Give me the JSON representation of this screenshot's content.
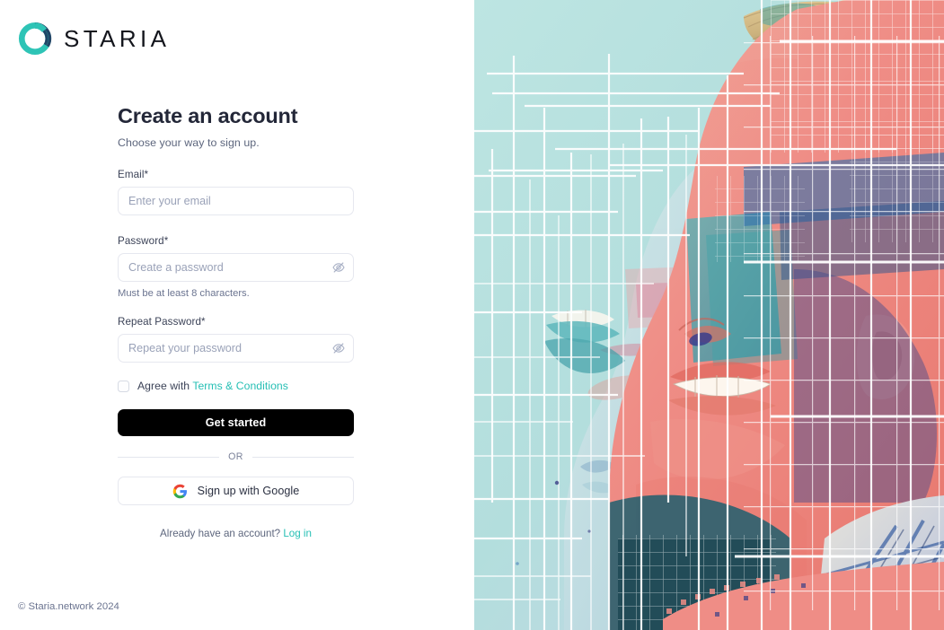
{
  "brand": {
    "name": "STARIA",
    "logo_icon": "staria-ring-logo",
    "colors": {
      "ring_teal": "#2ec4b6",
      "ring_dark": "#1f3a5f",
      "wordmark": "#14161d"
    }
  },
  "heading": {
    "title": "Create an account",
    "subtitle": "Choose your way to sign up."
  },
  "form": {
    "email": {
      "label": "Email*",
      "placeholder": "Enter your email",
      "value": ""
    },
    "password": {
      "label": "Password*",
      "placeholder": "Create a password",
      "value": "",
      "helper": "Must be at least 8 characters.",
      "toggle_icon": "eye-off-icon"
    },
    "repeat_password": {
      "label": "Repeat Password*",
      "placeholder": "Repeat your password",
      "value": "",
      "toggle_icon": "eye-off-icon"
    },
    "agree": {
      "checked": false,
      "text": "Agree with",
      "link_text": "Terms & Conditions"
    },
    "submit_label": "Get started",
    "divider_label": "OR",
    "google_label": "Sign up with Google",
    "google_icon": "google-g-icon"
  },
  "login_prompt": {
    "text": "Already have an account?",
    "link_text": "Log in"
  },
  "footer": {
    "copyright": "© Staria.network 2024"
  },
  "artwork": {
    "description": "Glitch-art collage of overlapping profile portraits with white grid overlay",
    "colors": {
      "background_mint": "#b9e2e0",
      "skin_coral": "#ef8d86",
      "teal": "#3fa3a8",
      "deep_blue": "#2c5f9e",
      "navy": "#23356b",
      "hair_blonde": "#d8c08c",
      "grid_white": "#ffffff"
    }
  },
  "accent_colors": {
    "teal_link": "#25bfb4",
    "primary_button": "#000000",
    "border": "#e6e8ef",
    "placeholder": "#9aa2b8"
  }
}
